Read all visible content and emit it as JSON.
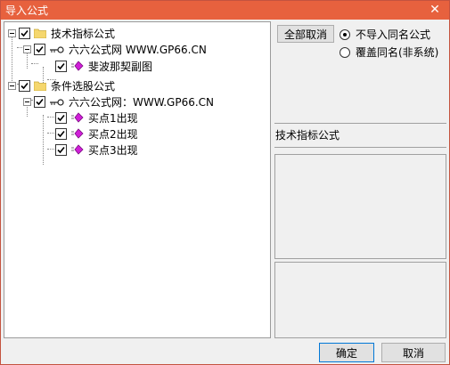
{
  "window": {
    "title": "导入公式",
    "close_glyph": "✕"
  },
  "tree": {
    "group1": {
      "label": "技术指标公式",
      "source": "六六公式网 WWW.GP66.CN",
      "item": "斐波那契副图"
    },
    "group2": {
      "label": "条件选股公式",
      "source": "六六公式网：WWW.GP66.CN",
      "items": [
        "买点1出现",
        "买点2出现",
        "买点3出现"
      ]
    }
  },
  "options": {
    "cancel_all_label": "全部取消",
    "radio1_label": "不导入同名公式",
    "radio2_label": "覆盖同名(非系统)",
    "selected": "radio1"
  },
  "info": {
    "section_label": "技术指标公式"
  },
  "footer": {
    "ok_label": "确定",
    "cancel_label": "取消"
  },
  "colors": {
    "titlebar": "#e7613e",
    "folder": "#f5d76e",
    "gem": "#d01fd8"
  },
  "icons": [
    "close-icon",
    "expander-icon",
    "checkbox-icon",
    "folder-icon",
    "connector-icon",
    "formula-icon",
    "radio-icon"
  ]
}
